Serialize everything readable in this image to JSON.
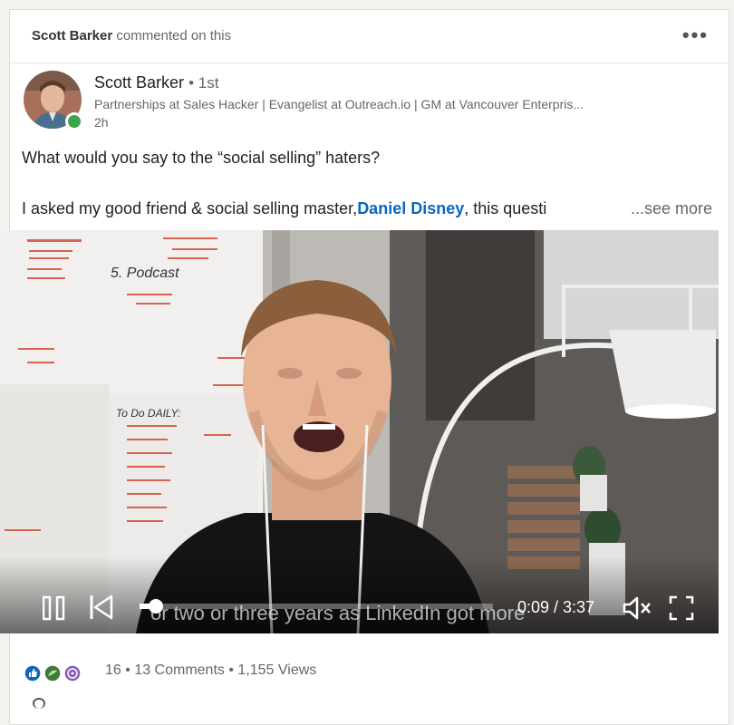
{
  "activity": {
    "actor": "Scott Barker",
    "action": "commented on this",
    "more_icon": "more-dots-icon"
  },
  "post": {
    "author_name": "Scott Barker",
    "connection_degree": "• 1st",
    "headline": "Partnerships at Sales Hacker | Evangelist at Outreach.io | GM at Vancouver Enterpris...",
    "timestamp": "2h",
    "text_line1": "What would you say to the “social selling” haters?",
    "text_line2_before": "I asked my good friend & social selling master,",
    "mention": "Daniel Disney",
    "text_line2_after": ", this questi",
    "see_more": "...see more"
  },
  "video": {
    "caption": "or two or three years as LinkedIn got more",
    "time_current": "0:09",
    "time_total": "3:37",
    "time_display": "0:09 / 3:37",
    "progress_fraction": 0.045,
    "whiteboard_heading": "To Do DAILY:",
    "whiteboard_item": "5. Podcast"
  },
  "social": {
    "reaction_count": "16",
    "separator": " • ",
    "comments": "13 Comments",
    "views": "1,155 Views",
    "reaction_icons": [
      "like-icon",
      "celebrate-icon",
      "curious-icon"
    ]
  },
  "colors": {
    "link": "#0a66c2",
    "online": "#3aa54a",
    "like_blue": "#0a66c2",
    "celebrate_green": "#3e7a3a",
    "curious_purple": "#8a5ab0"
  }
}
